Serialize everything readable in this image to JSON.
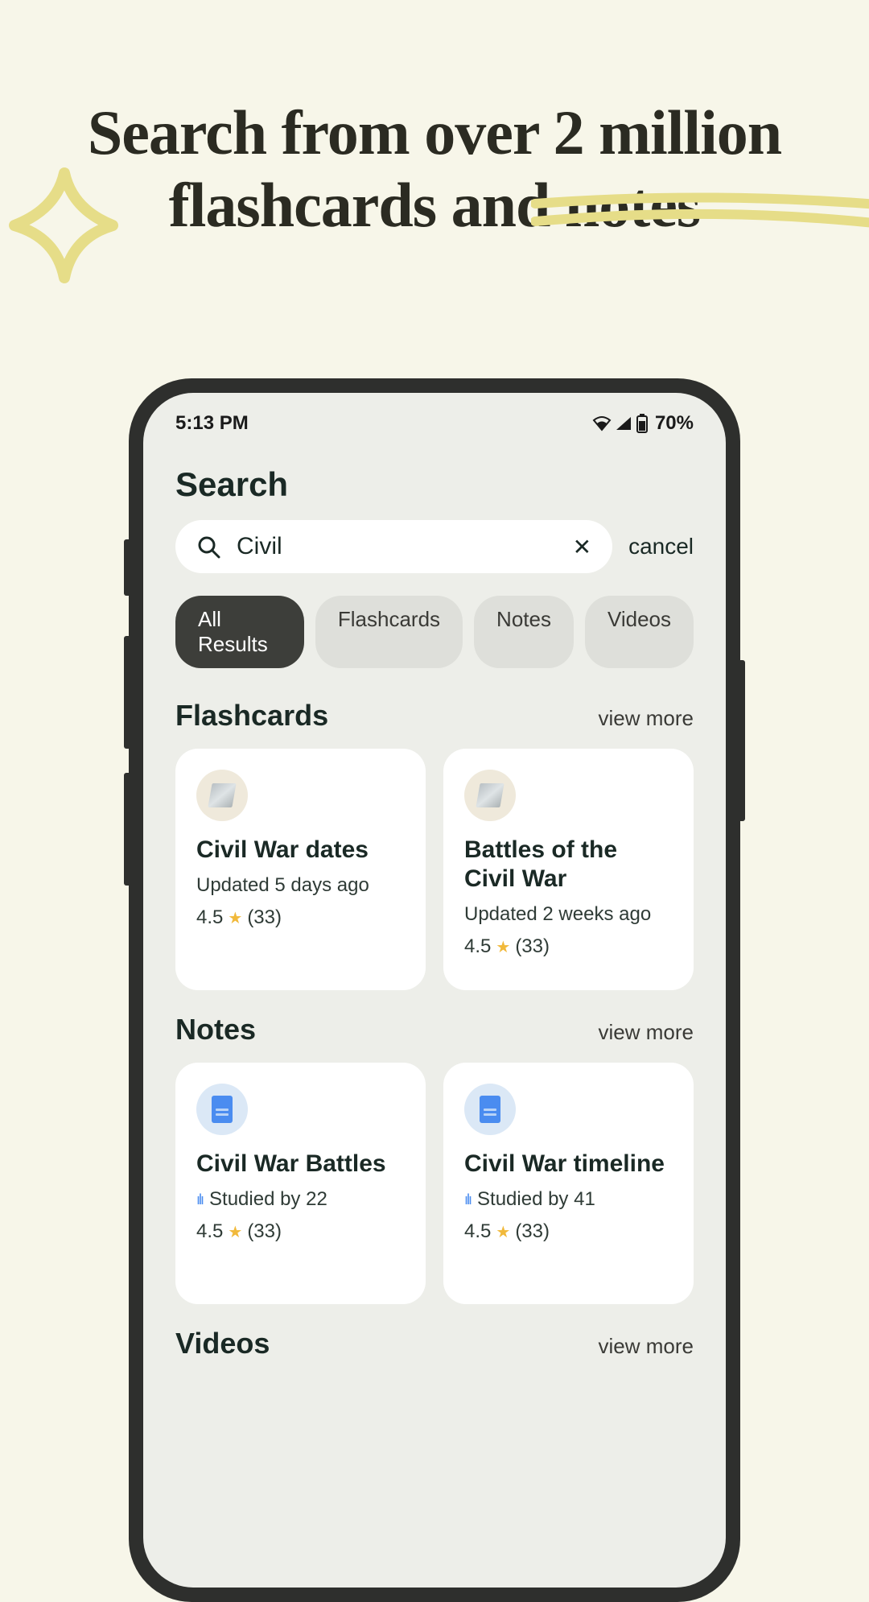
{
  "headline_line1_pre": "Search from over ",
  "headline_line1_bold": "2 million",
  "headline_line2": "flashcards and notes",
  "status": {
    "time": "5:13 PM",
    "battery": "70%"
  },
  "page_title": "Search",
  "search": {
    "value": "Civil",
    "cancel": "cancel"
  },
  "tabs": [
    "All Results",
    "Flashcards",
    "Notes",
    "Videos"
  ],
  "active_tab": 0,
  "flashcards": {
    "title": "Flashcards",
    "view_more": "view more",
    "items": [
      {
        "title": "Civil War dates",
        "updated": "Updated 5 days ago",
        "rating": "4.5",
        "count": "(33)"
      },
      {
        "title": "Battles of the Civil War",
        "updated": "Updated 2 weeks ago",
        "rating": "4.5",
        "count": "(33)"
      }
    ]
  },
  "notes": {
    "title": "Notes",
    "view_more": "view more",
    "items": [
      {
        "title": "Civil War Battles",
        "studied": "Studied by 22",
        "rating": "4.5",
        "count": "(33)"
      },
      {
        "title": "Civil War timeline",
        "studied": "Studied by 41",
        "rating": "4.5",
        "count": "(33)"
      }
    ]
  },
  "videos": {
    "title": "Videos",
    "view_more": "view more"
  }
}
